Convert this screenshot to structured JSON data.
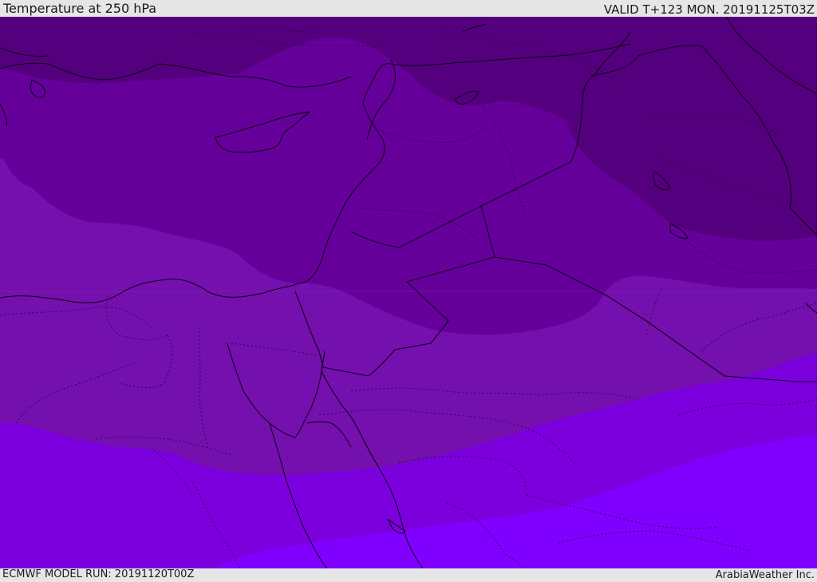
{
  "header": {
    "title": "Temperature at 250 hPa",
    "valid_time": "VALID T+123 MON. 20191125T03Z"
  },
  "footer": {
    "model_run": "ECMWF MODEL RUN: 20191120T00Z",
    "credit": "ArabiaWeather Inc."
  },
  "map": {
    "field": "temperature",
    "level": "250 hPa",
    "color_bands": [
      "#54007e",
      "#65009a",
      "#7410ad",
      "#7c00de",
      "#8000ff"
    ]
  }
}
